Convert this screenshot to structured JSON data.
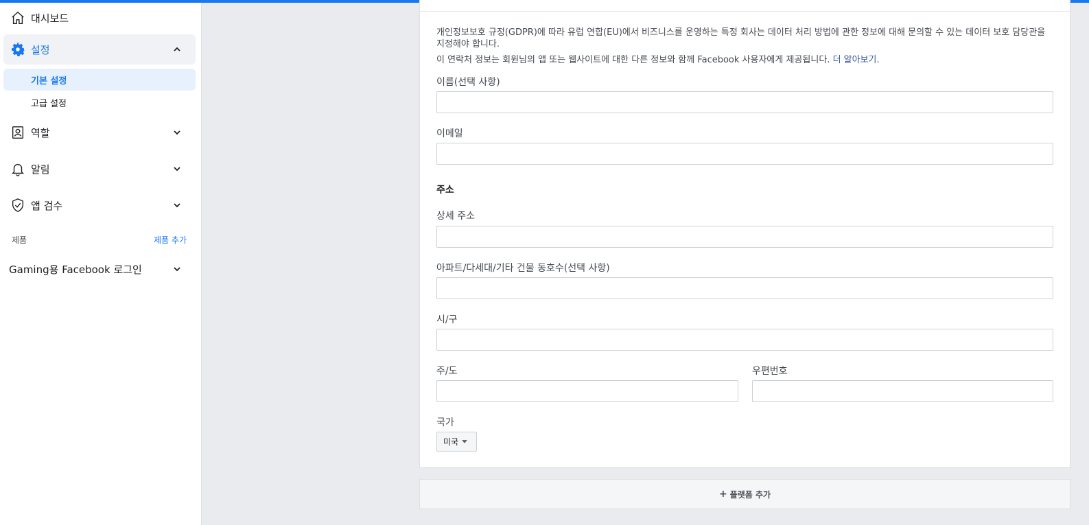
{
  "sidebar": {
    "dashboard": {
      "label": "대시보드",
      "icon": "home-icon"
    },
    "settings": {
      "label": "설정",
      "icon": "gear-icon"
    },
    "settings_sub": [
      {
        "label": "기본 설정"
      },
      {
        "label": "고급 설정"
      }
    ],
    "roles": {
      "label": "역할",
      "icon": "id-badge-icon"
    },
    "alerts": {
      "label": "알림",
      "icon": "bell-icon"
    },
    "app_review": {
      "label": "앱 검수",
      "icon": "shield-check-icon"
    },
    "products_label": "제품",
    "products_add": "제품 추가",
    "gaming": {
      "label": "Gaming용 Facebook 로그인"
    }
  },
  "form": {
    "description": "개인정보보호 규정(GDPR)에 따라 유럽 연합(EU)에서 비즈니스를 운영하는 특정 회사는 데이터 처리 방법에 관한 정보에 대해 문의할 수 있는 데이터 보호 담당관을 지정해야 합니다.",
    "description2": "이 연락처 정보는 회원님의 앱 또는 웹사이트에 대한 다른 정보와 함께 Facebook 사용자에게 제공됩니다.",
    "learn_more": "더 알아보기",
    "name_label": "이름(선택 사항)",
    "name_value": "",
    "email_label": "이메일",
    "email_value": "",
    "address_section": "주소",
    "street_label": "상세 주소",
    "street_value": "",
    "apt_label": "아파트/다세대/기타 건물 동호수(선택 사항)",
    "apt_value": "",
    "city_label": "시/구",
    "city_value": "",
    "state_label": "주/도",
    "state_value": "",
    "zip_label": "우편번호",
    "zip_value": "",
    "country_label": "국가",
    "country_selected": "미국"
  },
  "add_platform": "플랫폼 추가",
  "colors": {
    "accent": "#1877f2",
    "link": "#385898"
  }
}
